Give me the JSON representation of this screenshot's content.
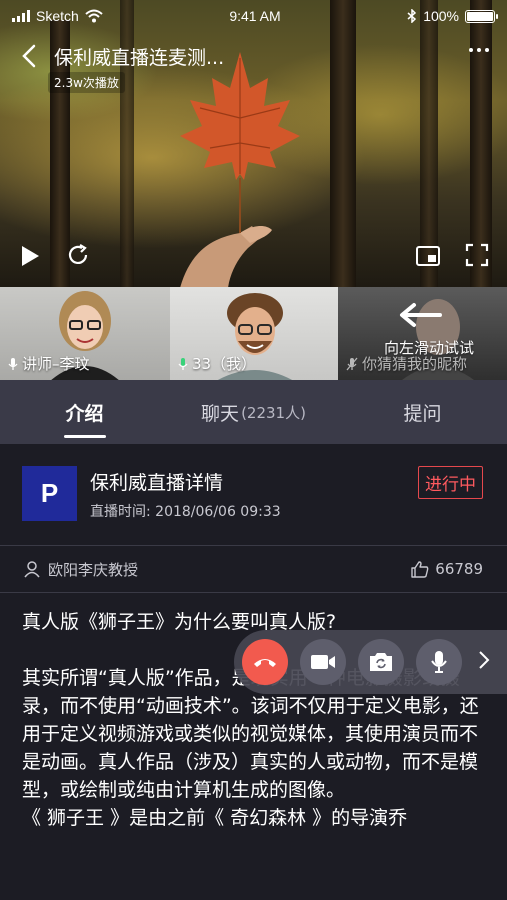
{
  "status_bar": {
    "carrier": "Sketch",
    "time": "9:41 AM",
    "battery": "100%"
  },
  "video": {
    "title": "保利威直播连麦测...",
    "views": "2.3w次播放"
  },
  "participants": [
    {
      "label": "讲师–李玟"
    },
    {
      "label": "33（我）"
    },
    {
      "label": "你猜猜我的昵称",
      "hint": "向左滑动试试"
    }
  ],
  "tabs": [
    {
      "label": "介绍",
      "count": ""
    },
    {
      "label": "聊天",
      "count": "(2231人)"
    },
    {
      "label": "提问",
      "count": ""
    }
  ],
  "info": {
    "logo_letter": "P",
    "title": "保利威直播详情",
    "time": "直播时间: 2018/06/06 09:33",
    "status": "进行中"
  },
  "author": {
    "name": "欧阳李庆教授",
    "likes": "66789"
  },
  "content": {
    "p1": "真人版《狮子王》为什么要叫真人版?",
    "p2": "其实所谓“真人版”作品，是现实用一种电影摄影或摄录，而不使用“动画技术”。该词不仅用于定义电影，还用于定义视频游戏或类似的视觉媒体，其使用演员而不是动画。真人作品（涉及）真实的人或动物，而不是模型，或绘制或纯由计算机生成的图像。",
    "p3": "《 狮子王 》是由之前《 奇幻森林 》的导演乔"
  },
  "colors": {
    "accent_red": "#f25a4e",
    "status_red": "#ff5a5f",
    "logo_blue": "#202a9a"
  }
}
